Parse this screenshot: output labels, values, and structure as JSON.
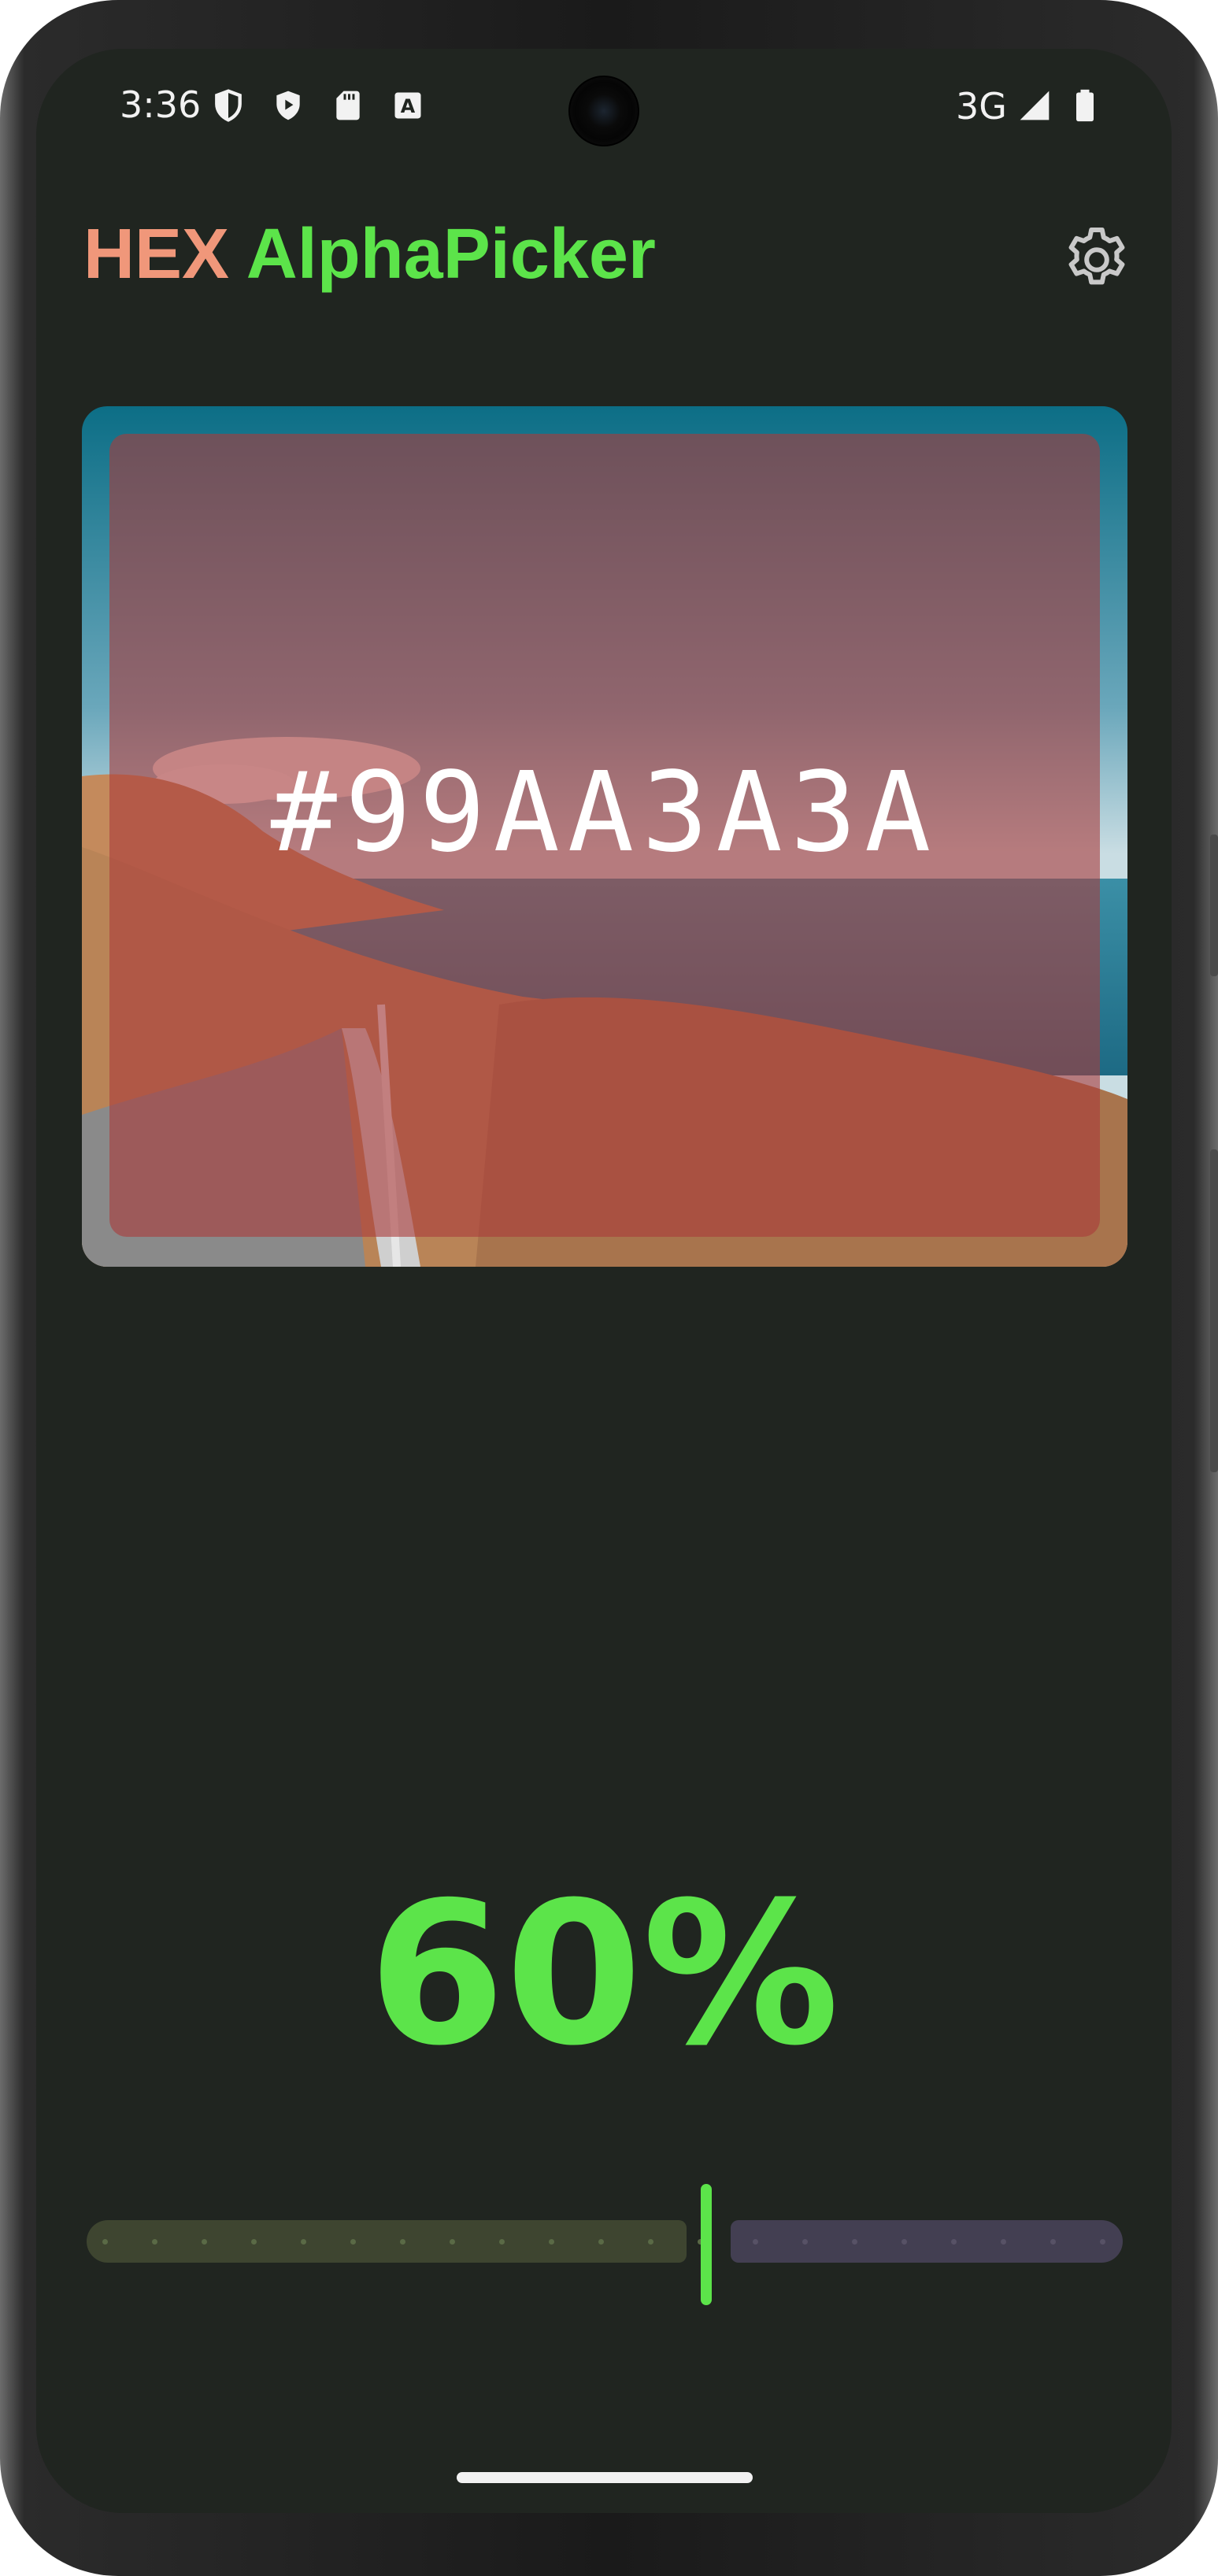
{
  "status_bar": {
    "time": "3:36",
    "network": "3G",
    "icons": [
      "shield-outline-icon",
      "shield-play-icon",
      "sd-card-icon",
      "keyboard-a-icon",
      "signal-icon",
      "battery-icon"
    ]
  },
  "app": {
    "title_hex": "HEX",
    "title_alpha": "AlphaPicker",
    "settings_icon": "gear-icon"
  },
  "preview": {
    "hex_code": "#99AA3A3A",
    "overlay_color": "#AA3A3A",
    "alpha": 0.6
  },
  "alpha_display": {
    "percent_text": "60%"
  },
  "slider": {
    "value": 0.6
  },
  "colors": {
    "background": "#202520",
    "accent_green": "#5CE44A",
    "title_orange": "#F0977A"
  }
}
